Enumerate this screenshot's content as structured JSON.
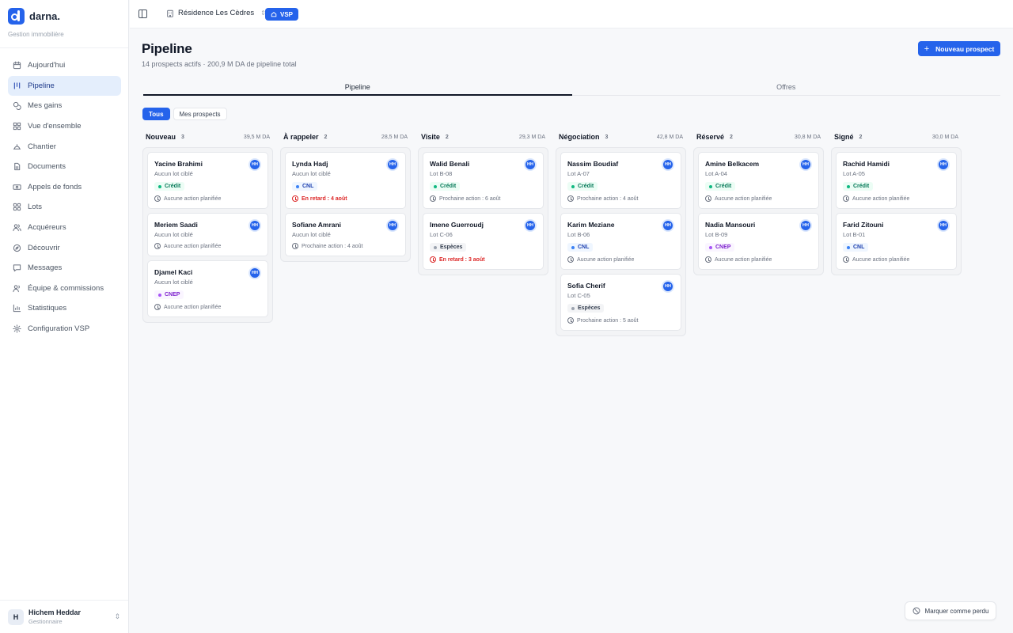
{
  "brand": {
    "name": "darna.",
    "subtitle": "Gestion immobilière"
  },
  "sidebar": {
    "items": [
      {
        "label": "Aujourd'hui",
        "icon": "calendar-icon",
        "active": false
      },
      {
        "label": "Pipeline",
        "icon": "pipeline-icon",
        "active": true
      },
      {
        "label": "Mes gains",
        "icon": "coins-icon",
        "active": false
      },
      {
        "label": "Vue d'ensemble",
        "icon": "grid-icon",
        "active": false
      },
      {
        "label": "Chantier",
        "icon": "helmet-icon",
        "active": false
      },
      {
        "label": "Documents",
        "icon": "document-icon",
        "active": false
      },
      {
        "label": "Appels de fonds",
        "icon": "banknote-icon",
        "active": false
      },
      {
        "label": "Lots",
        "icon": "lots-icon",
        "active": false
      },
      {
        "label": "Acquéreurs",
        "icon": "users-icon",
        "active": false
      },
      {
        "label": "Découvrir",
        "icon": "compass-icon",
        "active": false
      },
      {
        "label": "Messages",
        "icon": "message-icon",
        "active": false
      },
      {
        "label": "Équipe & commissions",
        "icon": "team-icon",
        "active": false
      },
      {
        "label": "Statistiques",
        "icon": "chart-icon",
        "active": false
      },
      {
        "label": "Configuration VSP",
        "icon": "settings-icon",
        "active": false
      }
    ]
  },
  "user": {
    "initial": "H",
    "name": "Hichem Heddar",
    "role": "Gestionnaire"
  },
  "topbar": {
    "residence": "Résidence Les Cèdres",
    "badge": "VSP"
  },
  "page": {
    "title": "Pipeline",
    "subtitle": "14 prospects actifs · 200,9 M DA de pipeline total",
    "new_button": "Nouveau prospect",
    "tabs": [
      "Pipeline",
      "Offres"
    ],
    "filters": [
      "Tous",
      "Mes prospects"
    ],
    "lost_button": "Marquer comme perdu"
  },
  "columns": [
    {
      "name": "Nouveau",
      "count": "3",
      "amount": "39,5 M DA",
      "cards": [
        {
          "name": "Yacine Brahimi",
          "lot": "Aucun lot ciblé",
          "avatar": "HH",
          "badge": "Crédit",
          "badge_type": "credit",
          "action": "Aucune action planifiée",
          "late": false
        },
        {
          "name": "Meriem Saadi",
          "lot": "Aucun lot ciblé",
          "avatar": "HH",
          "badge": "",
          "badge_type": "",
          "action": "Aucune action planifiée",
          "late": false
        },
        {
          "name": "Djamel Kaci",
          "lot": "Aucun lot ciblé",
          "avatar": "HH",
          "badge": "CNEP",
          "badge_type": "cnep",
          "action": "Aucune action planifiée",
          "late": false
        }
      ]
    },
    {
      "name": "À rappeler",
      "count": "2",
      "amount": "28,5 M DA",
      "cards": [
        {
          "name": "Lynda Hadj",
          "lot": "Aucun lot ciblé",
          "avatar": "HH",
          "badge": "CNL",
          "badge_type": "cnl",
          "action": "En retard : 4 août",
          "late": true
        },
        {
          "name": "Sofiane Amrani",
          "lot": "Aucun lot ciblé",
          "avatar": "HH",
          "badge": "",
          "badge_type": "",
          "action": "Prochaine action : 4 août",
          "late": false
        }
      ]
    },
    {
      "name": "Visite",
      "count": "2",
      "amount": "29,3 M DA",
      "cards": [
        {
          "name": "Walid Benali",
          "lot": "Lot B-08",
          "avatar": "HH",
          "badge": "Crédit",
          "badge_type": "credit",
          "action": "Prochaine action : 6 août",
          "late": false
        },
        {
          "name": "Imene Guerroudj",
          "lot": "Lot C-06",
          "avatar": "HH",
          "badge": "Espèces",
          "badge_type": "especes",
          "action": "En retard : 3 août",
          "late": true
        }
      ]
    },
    {
      "name": "Négociation",
      "count": "3",
      "amount": "42,8 M DA",
      "cards": [
        {
          "name": "Nassim Boudiaf",
          "lot": "Lot A-07",
          "avatar": "HH",
          "badge": "Crédit",
          "badge_type": "credit",
          "action": "Prochaine action : 4 août",
          "late": false
        },
        {
          "name": "Karim Meziane",
          "lot": "Lot B-06",
          "avatar": "HH",
          "badge": "CNL",
          "badge_type": "cnl",
          "action": "Aucune action planifiée",
          "late": false
        },
        {
          "name": "Sofia Cherif",
          "lot": "Lot C-05",
          "avatar": "HH",
          "badge": "Espèces",
          "badge_type": "especes",
          "action": "Prochaine action : 5 août",
          "late": false
        }
      ]
    },
    {
      "name": "Réservé",
      "count": "2",
      "amount": "30,8 M DA",
      "cards": [
        {
          "name": "Amine Belkacem",
          "lot": "Lot A-04",
          "avatar": "HH",
          "badge": "Crédit",
          "badge_type": "credit",
          "action": "Aucune action planifiée",
          "late": false
        },
        {
          "name": "Nadia Mansouri",
          "lot": "Lot B-09",
          "avatar": "HH",
          "badge": "CNEP",
          "badge_type": "cnep",
          "action": "Aucune action planifiée",
          "late": false
        }
      ]
    },
    {
      "name": "Signé",
      "count": "2",
      "amount": "30,0 M DA",
      "cards": [
        {
          "name": "Rachid Hamidi",
          "lot": "Lot A-05",
          "avatar": "HH",
          "badge": "Crédit",
          "badge_type": "credit",
          "action": "Aucune action planifiée",
          "late": false
        },
        {
          "name": "Farid Zitouni",
          "lot": "Lot B-01",
          "avatar": "HH",
          "badge": "CNL",
          "badge_type": "cnl",
          "action": "Aucune action planifiée",
          "late": false
        }
      ]
    }
  ]
}
